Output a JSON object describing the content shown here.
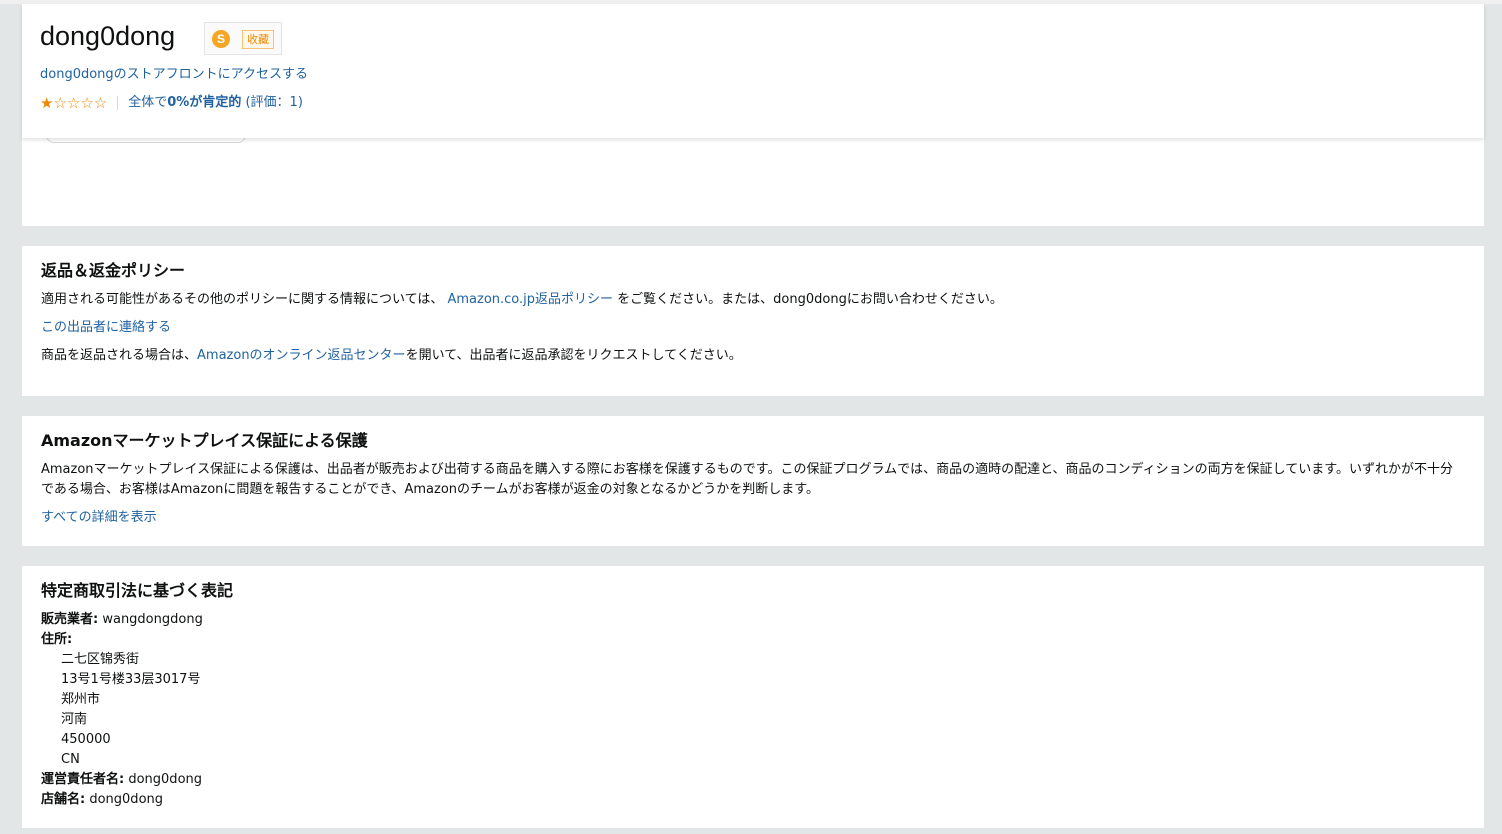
{
  "seller": {
    "name": "dong0dong",
    "ext_icon_letter": "S",
    "collect_label": "收藏",
    "storefront_link": "dong0dongのストアフロントにアクセスする",
    "stars": "★☆☆☆☆",
    "rating_value": 1,
    "rating_max": 5,
    "rating_prefix": "全体で",
    "rating_percent": "0%が肯定的",
    "rating_count": "(評価：1)"
  },
  "returns": {
    "title": "返品＆返金ポリシー",
    "line1_prefix": "適用される可能性があるその他のポリシーに関する情報については、 ",
    "line1_link": "Amazon.co.jp返品ポリシー",
    "line1_suffix": " をご覧ください。または、dong0dongにお問い合わせください。",
    "contact_link": "この出品者に連絡する",
    "line3_prefix": "商品を返品される場合は、",
    "line3_link": "Amazonのオンライン返品センター",
    "line3_suffix": "を開いて、出品者に返品承認をリクエストしてください。"
  },
  "guarantee": {
    "title": "Amazonマーケットプレイス保証による保護",
    "body": "Amazonマーケットプレイス保証による保護は、出品者が販売および出荷する商品を購入する際にお客様を保護するものです。この保証プログラムでは、商品の適時の配達と、商品のコンディションの両方を保証しています。いずれかが不十分である場合、お客様はAmazonに問題を報告することができ、Amazonのチームがお客様が返金の対象となるかどうかを判断します。",
    "details_link": "すべての詳細を表示"
  },
  "legal": {
    "title": "特定商取引法に基づく表記",
    "seller_label": "販売業者:",
    "seller_value": "wangdongdong",
    "address_label": "住所:",
    "address_lines": [
      "二七区锦秀街",
      "13号1号楼33层3017号",
      "郑州市",
      "河南",
      "450000",
      "CN"
    ],
    "manager_label": "運営責任者名:",
    "manager_value": "dong0dong",
    "store_label": "店舗名:",
    "store_value": "dong0dong"
  },
  "colors": {
    "link": "#2162a1",
    "star": "#f08804",
    "background": "#e3e6e6",
    "panel": "#ffffff"
  }
}
